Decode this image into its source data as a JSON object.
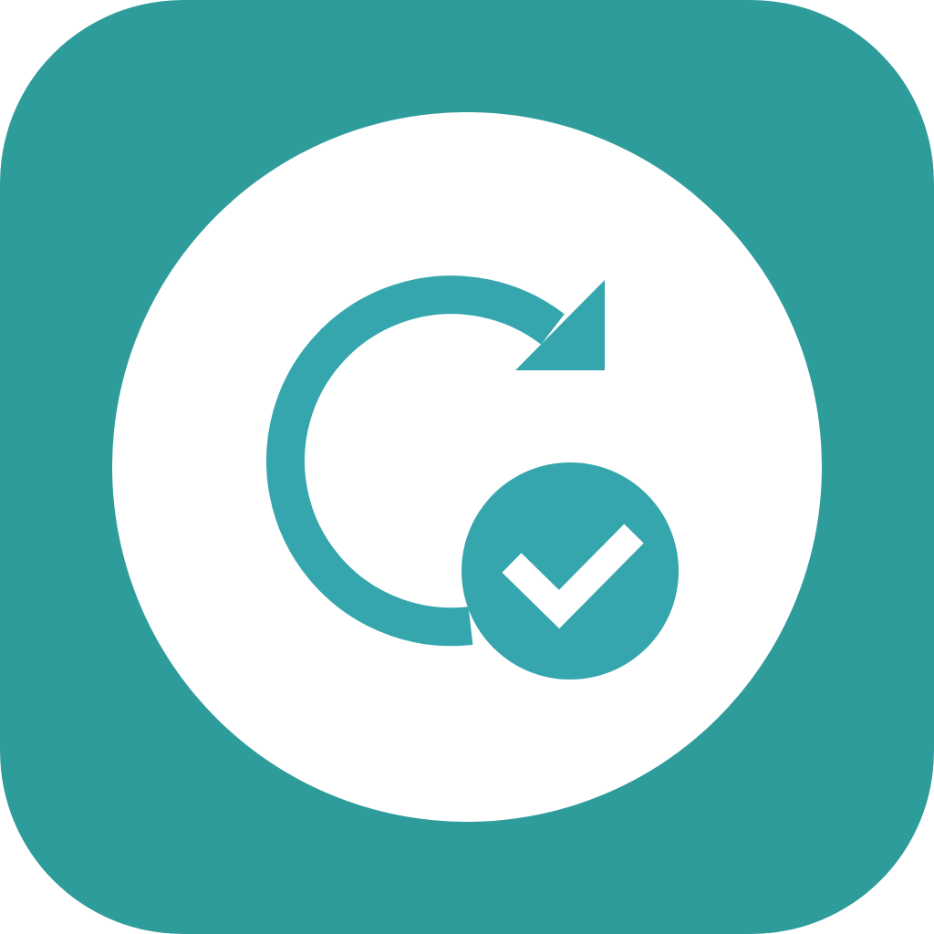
{
  "icon": {
    "name": "sync-check-app-icon",
    "glyphs": [
      "circular-arrow-icon",
      "checkmark-badge-icon"
    ]
  },
  "colors": {
    "tile_background": "#2F9C9C",
    "disc": "#FFFFFF",
    "glyph": "#36A6AE",
    "check": "#FFFFFF"
  }
}
